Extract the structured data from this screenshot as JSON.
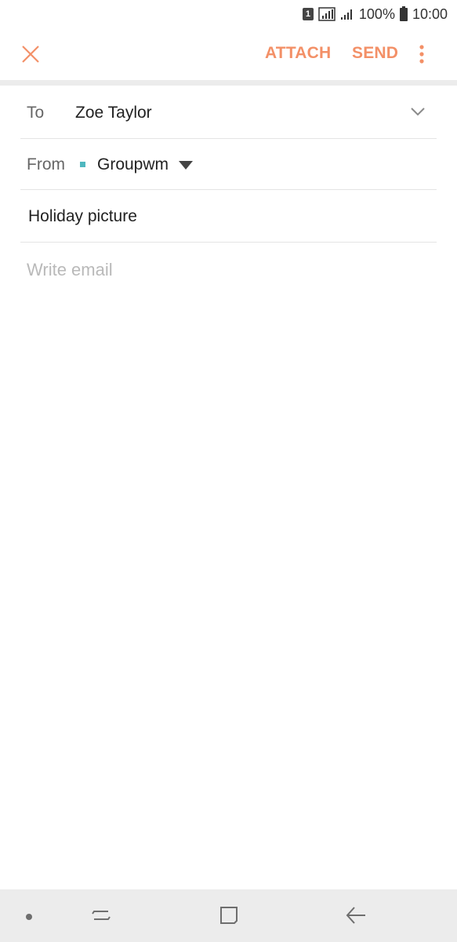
{
  "status_bar": {
    "sim": "1",
    "battery": "100%",
    "time": "10:00"
  },
  "toolbar": {
    "attach_label": "ATTACH",
    "send_label": "SEND",
    "accent_color": "#f39067"
  },
  "compose": {
    "to_label": "To",
    "to_value": "Zoe Taylor",
    "from_label": "From",
    "from_value": "Groupwm",
    "subject_value": "Holiday picture",
    "body_placeholder": "Write email"
  },
  "icons": {
    "close": "close-icon",
    "more": "more-vert-icon",
    "to_expand": "chevron-down-icon",
    "from_dropdown": "caret-down-icon",
    "recents": "recents-icon",
    "home": "home-icon",
    "back": "back-icon"
  }
}
